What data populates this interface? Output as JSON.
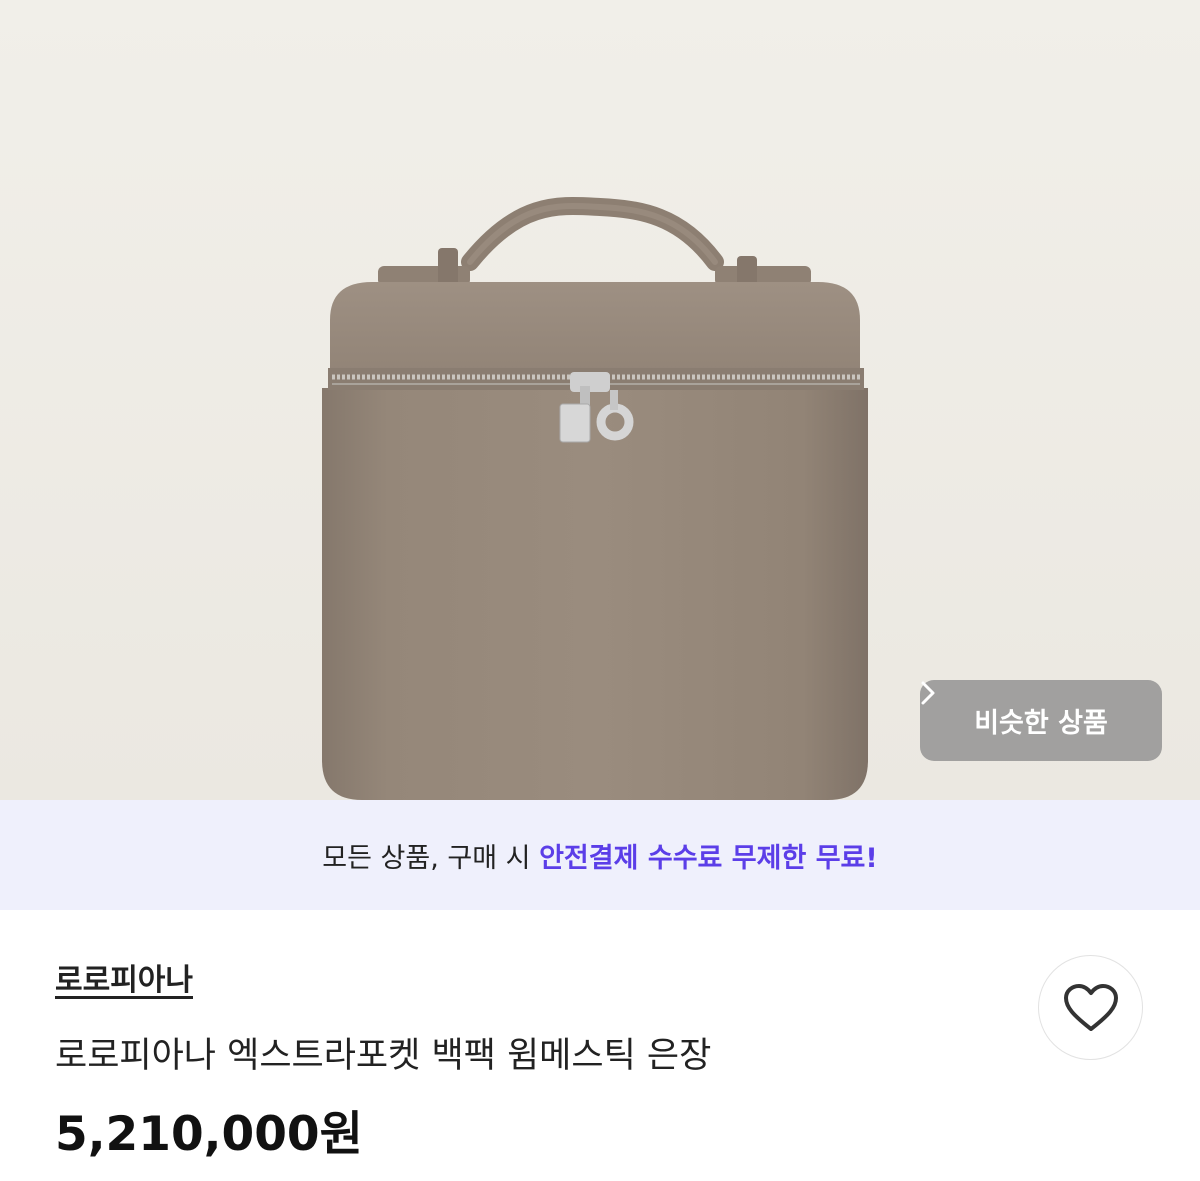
{
  "product_image": {
    "alt": "로로피아나 엑스트라포켓 백팩 윔메스틱 은장"
  },
  "similar_button": {
    "label": "비슷한 상품",
    "icon": "chevron-right-icon"
  },
  "promo_banner": {
    "prefix": "모든 상품, 구매 시 ",
    "highlight": "안전결제 수수료 무제한 무료!",
    "highlight_color": "#5b3ee8"
  },
  "product": {
    "brand": "로로피아나",
    "title": "로로피아나 엑스트라포켓 백팩 윔메스틱 은장",
    "price": "5,210,000원"
  },
  "like_button": {
    "icon": "heart-outline-icon"
  }
}
